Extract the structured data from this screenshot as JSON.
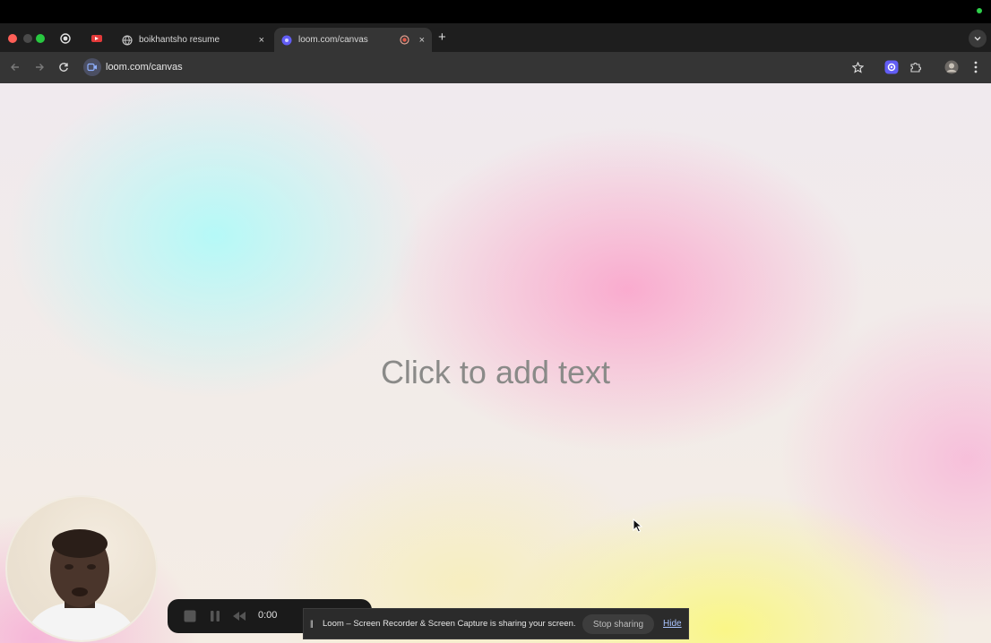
{
  "browser": {
    "tabs": [
      {
        "label": "boikhantsho resume",
        "close": "×"
      },
      {
        "label": "loom.com/canvas",
        "close": "×"
      }
    ],
    "new_tab": "+",
    "address": "loom.com/canvas"
  },
  "canvas": {
    "placeholder": "Click to add text"
  },
  "recorder": {
    "timer": "0:00"
  },
  "share_bar": {
    "pause_glyph": "||",
    "message": "Loom – Screen Recorder & Screen Capture is sharing your screen.",
    "stop_label": "Stop sharing",
    "hide_label": "Hide"
  },
  "colors": {
    "chrome_dark": "#1e1e1e",
    "toolbar": "#353535",
    "loom_accent": "#625df5",
    "record_red": "#e33a3a"
  }
}
